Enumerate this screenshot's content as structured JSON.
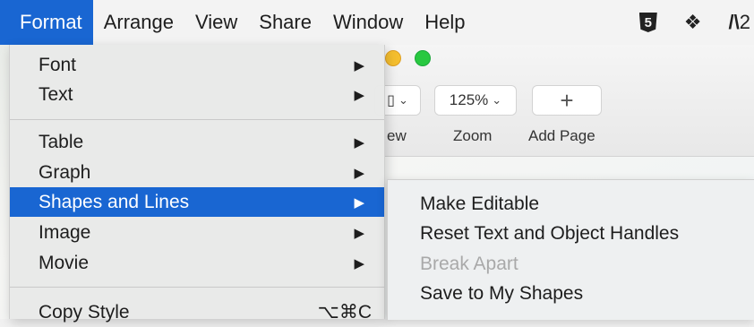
{
  "menubar": {
    "items": [
      "Format",
      "Arrange",
      "View",
      "Share",
      "Window",
      "Help"
    ],
    "active": "Format",
    "status_text": "2"
  },
  "toolbar": {
    "view_label": "ew",
    "zoom_value": "125%",
    "zoom_label": "Zoom",
    "add_page_symbol": "+",
    "add_page_label": "Add Page"
  },
  "format_menu": {
    "items": [
      {
        "label": "Font",
        "submenu": true
      },
      {
        "label": "Text",
        "submenu": true
      },
      {
        "label": "Table",
        "submenu": true
      },
      {
        "label": "Graph",
        "submenu": true
      },
      {
        "label": "Shapes and Lines",
        "submenu": true,
        "highlighted": true
      },
      {
        "label": "Image",
        "submenu": true
      },
      {
        "label": "Movie",
        "submenu": true
      },
      {
        "label": "Copy Style",
        "shortcut": "⌥⌘C"
      }
    ]
  },
  "shapes_submenu": {
    "items": [
      {
        "label": "Make Editable",
        "enabled": true
      },
      {
        "label": "Reset Text and Object Handles",
        "enabled": true
      },
      {
        "label": "Break Apart",
        "enabled": false
      },
      {
        "label": "Save to My Shapes",
        "enabled": true
      }
    ]
  },
  "colors": {
    "highlight": "#1966d2",
    "disabled_text": "#a9a9a9"
  }
}
